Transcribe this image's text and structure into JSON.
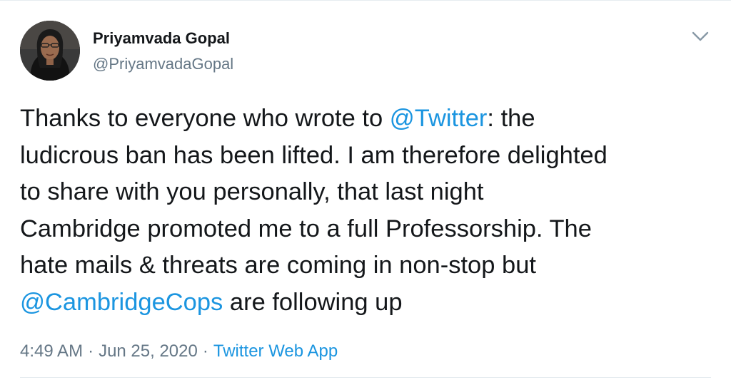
{
  "tweet": {
    "author": {
      "display_name": "Priyamvada Gopal",
      "handle": "@PriyamvadaGopal"
    },
    "menu_icon": "chevron-down-icon",
    "text_lines": [
      [
        {
          "text": "Thanks to everyone who wrote to ",
          "type": "text"
        },
        {
          "text": "@Twitter",
          "type": "mention"
        },
        {
          "text": ": the",
          "type": "text"
        }
      ],
      [
        {
          "text": "ludicrous ban has been lifted. I am therefore delighted",
          "type": "text"
        }
      ],
      [
        {
          "text": "to share with you personally, that last night",
          "type": "text"
        }
      ],
      [
        {
          "text": "Cambridge promoted me to a full Professorship. The",
          "type": "text"
        }
      ],
      [
        {
          "text": "hate mails & threats are coming in non-stop but",
          "type": "text"
        }
      ],
      [
        {
          "text": "@CambridgeCops",
          "type": "mention"
        },
        {
          "text": " are following up",
          "type": "text"
        }
      ]
    ],
    "meta": {
      "time": "4:49 AM",
      "separator": "·",
      "date": "Jun 25, 2020",
      "source": "Twitter Web App"
    },
    "colors": {
      "link": "#1b95e0",
      "text": "#14171a",
      "muted": "#657786"
    }
  }
}
